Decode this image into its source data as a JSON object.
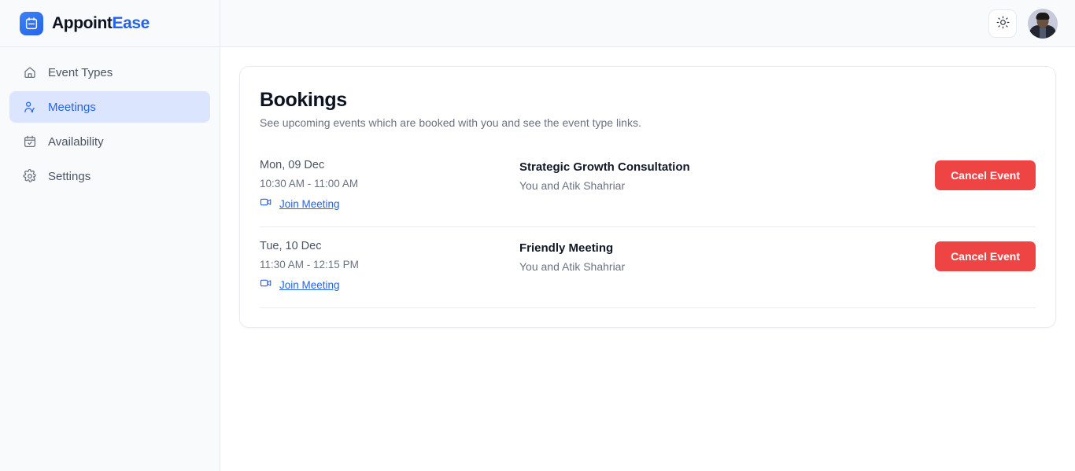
{
  "brand": {
    "name_part1": "Appoint",
    "name_part2": "Ease",
    "logo_icon": "calendar-icon"
  },
  "sidebar": {
    "items": [
      {
        "label": "Event Types",
        "icon": "home-icon",
        "active": false
      },
      {
        "label": "Meetings",
        "icon": "users-icon",
        "active": true
      },
      {
        "label": "Availability",
        "icon": "calendar-check-icon",
        "active": false
      },
      {
        "label": "Settings",
        "icon": "gear-icon",
        "active": false
      }
    ]
  },
  "topbar": {
    "theme_toggle_icon": "sun-icon",
    "avatar_icon": "user-avatar"
  },
  "main": {
    "title": "Bookings",
    "subtitle": "See upcoming events which are booked with you and see the event type links.",
    "join_label": "Join Meeting",
    "join_icon": "video-camera-icon",
    "cancel_label": "Cancel Event",
    "bookings": [
      {
        "date": "Mon, 09 Dec",
        "time": "10:30 AM - 11:00 AM",
        "join_label": "Join Meeting",
        "event_title": "Strategic Growth Consultation",
        "participants": "You and Atik Shahriar",
        "cancel_label": "Cancel Event"
      },
      {
        "date": "Tue, 10 Dec",
        "time": "11:30 AM - 12:15 PM",
        "join_label": "Join Meeting",
        "event_title": "Friendly Meeting",
        "participants": "You and Atik Shahriar",
        "cancel_label": "Cancel Event"
      }
    ]
  },
  "colors": {
    "brand_blue": "#2563eb",
    "danger_red": "#ef4444",
    "active_nav_bg": "#dbe5fd",
    "sidebar_bg": "#f8fafc",
    "border": "#e6eaf0"
  }
}
